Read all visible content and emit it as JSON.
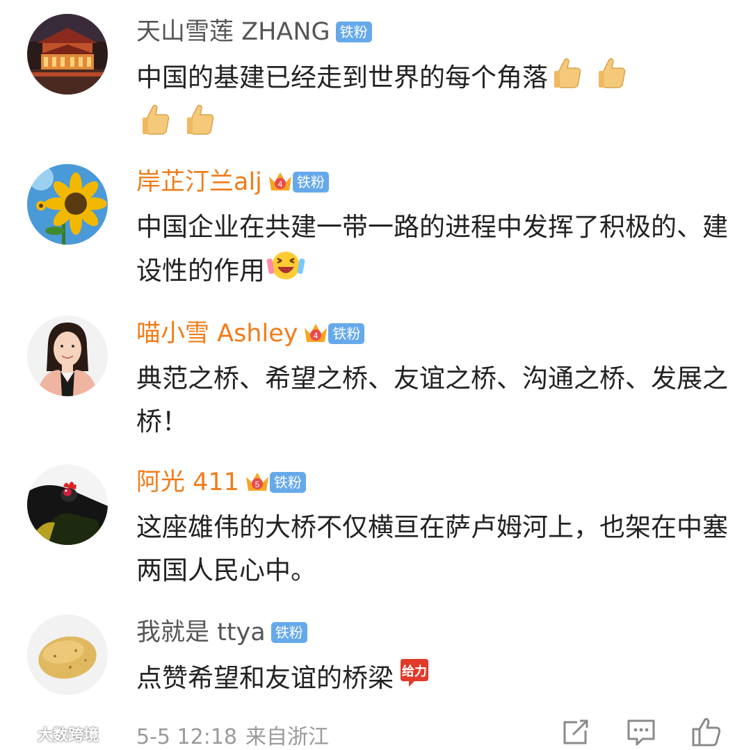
{
  "comments": [
    {
      "username": "天山雪莲 ZHANG",
      "badge": "铁粉",
      "text": "中国的基建已经走到世界的每个角落",
      "avatar_icon": "palace-avatar",
      "emojis": [
        "thumbs-up-icon",
        "thumbs-up-icon",
        "thumbs-up-icon",
        "thumbs-up-icon"
      ]
    },
    {
      "username": "岸芷汀兰alj",
      "badge": "铁粉",
      "crown_level": "4",
      "text": "中国企业在共建一带一路的进程中发挥了积极的、建设性的作用",
      "avatar_icon": "sunflower-avatar",
      "emojis": [
        "laughing-face-icon"
      ]
    },
    {
      "username": "喵小雪 Ashley",
      "badge": "铁粉",
      "crown_level": "4",
      "text": "典范之桥、希望之桥、友谊之桥、沟通之桥、发展之桥！",
      "avatar_icon": "woman-portrait-avatar"
    },
    {
      "username": "阿光 411",
      "badge": "铁粉",
      "crown_level": "5",
      "text": "这座雄伟的大桥不仅横亘在萨卢姆河上，也架在中塞两国人民心中。",
      "avatar_icon": "rooster-avatar"
    },
    {
      "username": "我就是 ttya",
      "badge": "铁粉",
      "text": "点赞希望和友谊的桥梁",
      "avatar_icon": "potato-avatar",
      "emojis": [
        "cheer-sticker-icon"
      ],
      "cheer_sticker_text": "给力"
    }
  ],
  "footer": {
    "time": "5-5 12:18",
    "source": "来自浙江",
    "icons": [
      "share-icon",
      "comment-icon",
      "like-icon"
    ]
  },
  "watermark": "大数跨境",
  "colors": {
    "vip_name": "#f07c19",
    "normal_name": "#555555",
    "badge_bg": "#66a9ea",
    "crown": "#f5a623"
  }
}
